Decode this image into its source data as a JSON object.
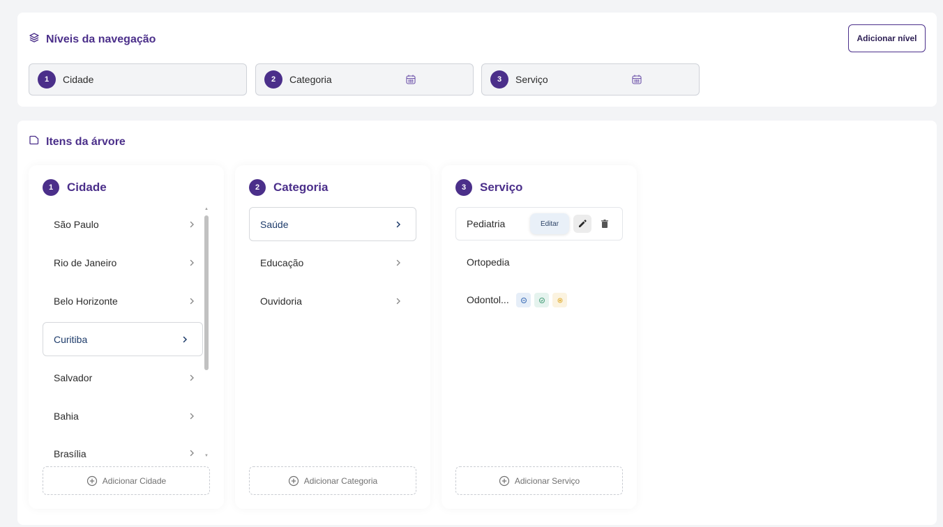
{
  "navigation_levels": {
    "title": "Níveis da navegação",
    "add_button": "Adicionar nível",
    "levels": [
      {
        "number": "1",
        "label": "Cidade"
      },
      {
        "number": "2",
        "label": "Categoria"
      },
      {
        "number": "3",
        "label": "Serviço"
      }
    ]
  },
  "tree": {
    "title": "Itens da árvore",
    "columns": [
      {
        "number": "1",
        "title": "Cidade",
        "items": [
          "São Paulo",
          "Rio de Janeiro",
          "Belo Horizonte",
          "Curitiba",
          "Salvador",
          "Bahia",
          "Brasília"
        ],
        "selected": "Curitiba",
        "add_label": "Adicionar Cidade"
      },
      {
        "number": "2",
        "title": "Categoria",
        "items": [
          "Saúde",
          "Educação",
          "Ouvidoria"
        ],
        "selected": "Saúde",
        "add_label": "Adicionar Categoria"
      },
      {
        "number": "3",
        "title": "Serviço",
        "items": [
          "Pediatria",
          "Ortopedia",
          "Odontol..."
        ],
        "edit_label": "Editar",
        "add_label": "Adicionar Serviço"
      }
    ]
  },
  "colors": {
    "accent": "#4b2f8a",
    "background": "#f3f4f6",
    "selected_text": "#1d3b6a"
  },
  "icons": {
    "levels_title": "layers-icon",
    "tree_title": "folder-icon",
    "level_calendar": "calendar-icon",
    "item_arrow": "chevron-right-icon",
    "add": "plus-circle-icon",
    "edit": "pencil-icon",
    "delete": "trash-icon"
  }
}
